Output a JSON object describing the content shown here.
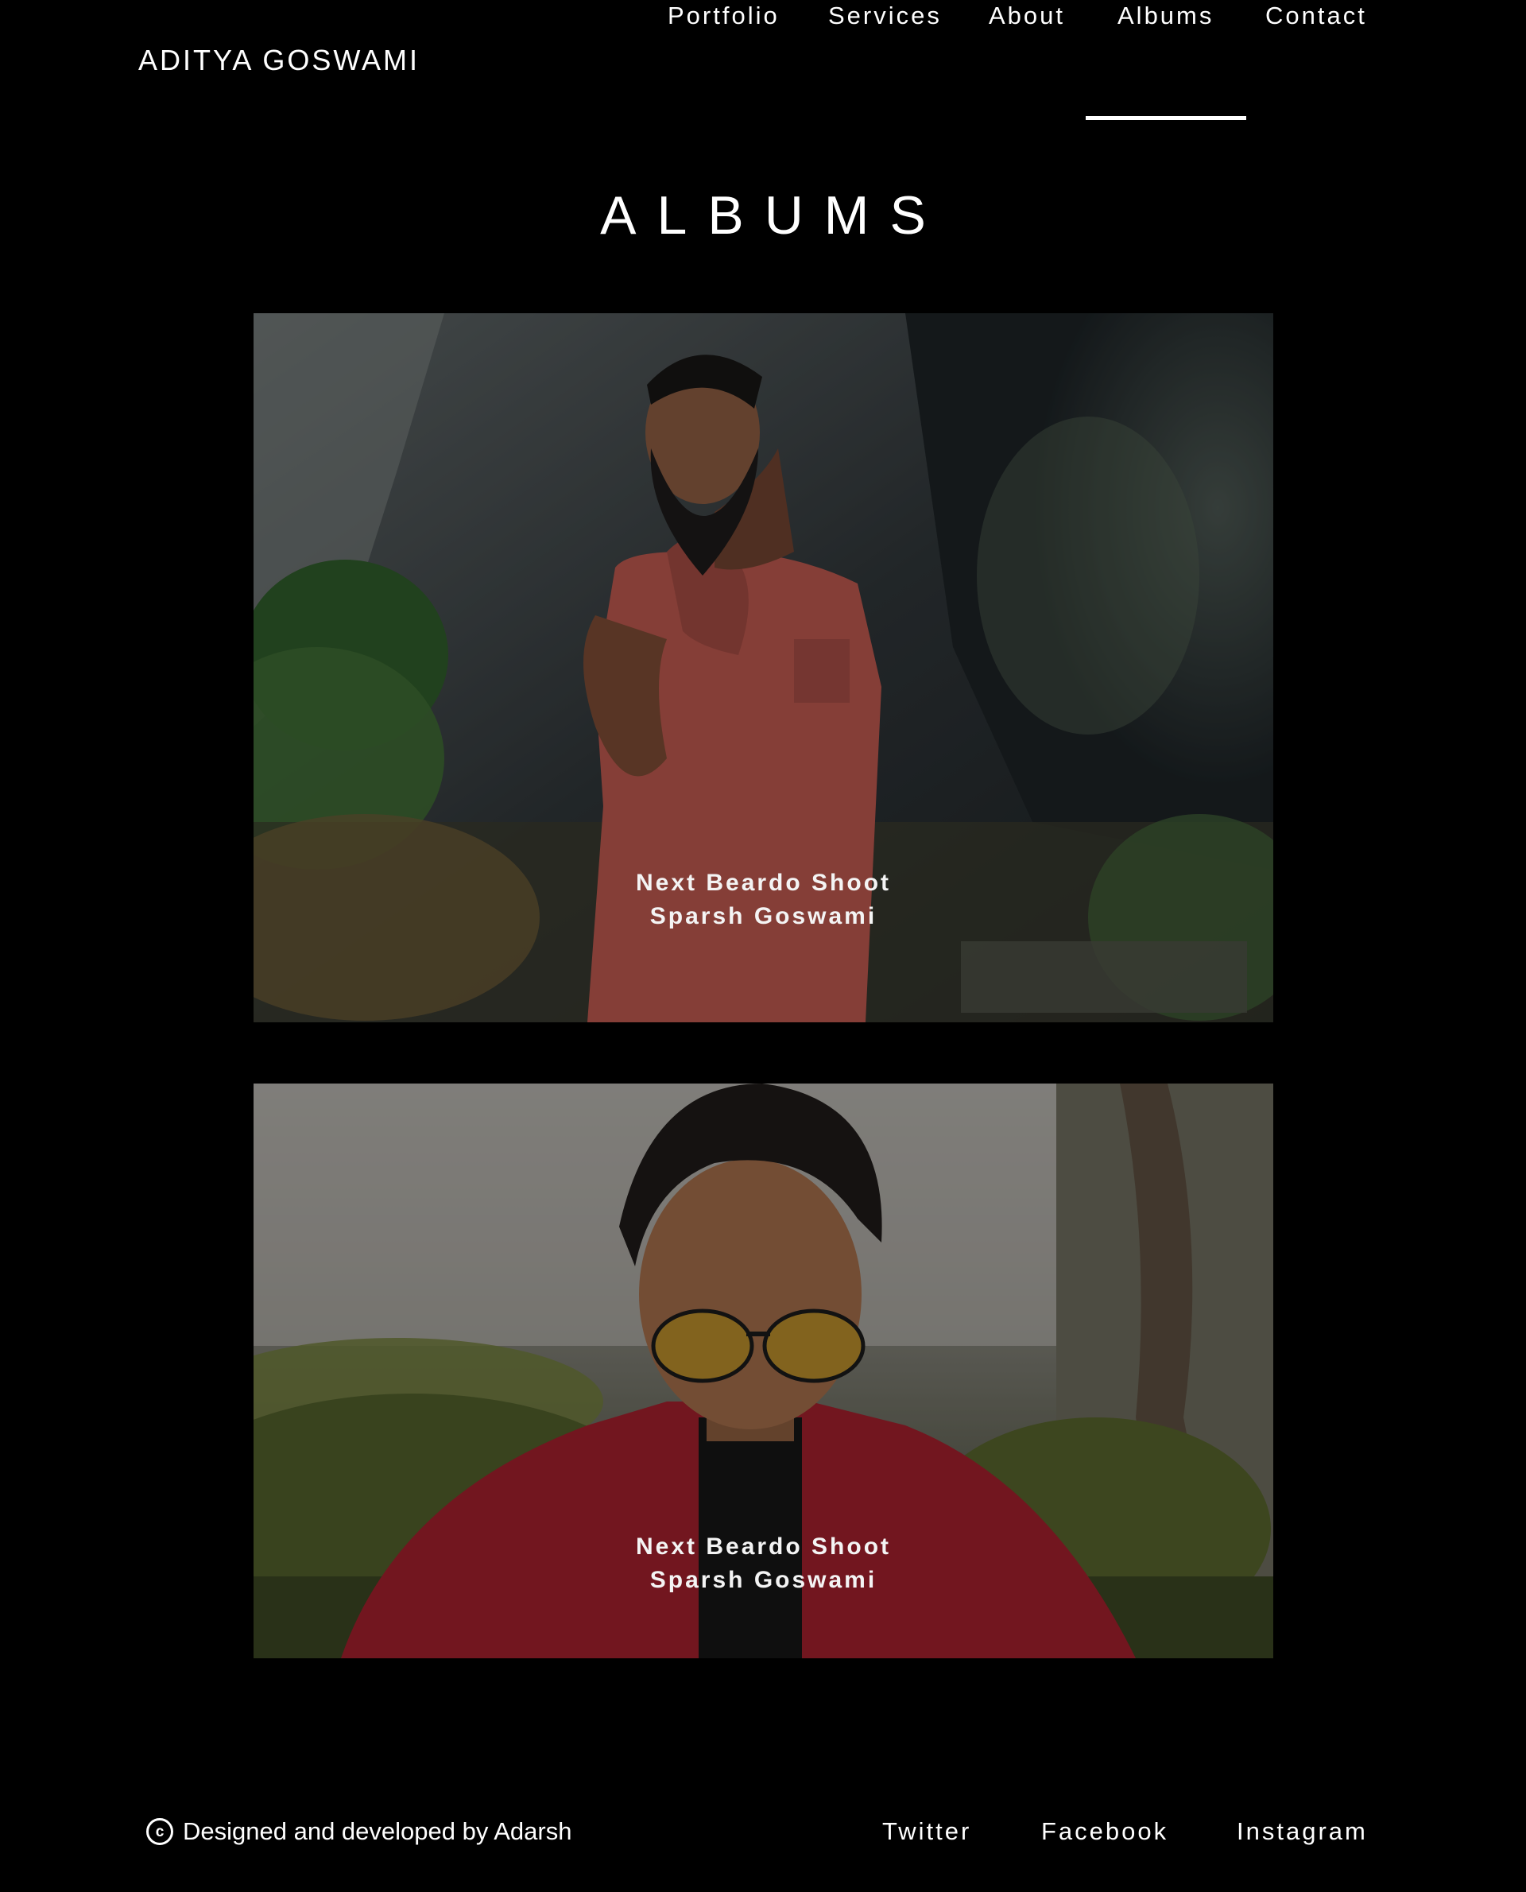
{
  "header": {
    "brand": "ADITYA GOSWAMI",
    "nav": [
      {
        "label": "Portfolio"
      },
      {
        "label": "Services"
      },
      {
        "label": "About"
      },
      {
        "label": "Albums",
        "active": true
      },
      {
        "label": "Contact"
      }
    ]
  },
  "main": {
    "title": "ALBUMS",
    "albums": [
      {
        "caption_line1": "Next Beardo Shoot",
        "caption_line2": "Sparsh Goswami",
        "photo": "man-red-sleeveless-shirt-mountains"
      },
      {
        "caption_line1": "Next Beardo Shoot",
        "caption_line2": "Sparsh Goswami",
        "photo": "man-yellow-sunglasses-red-jacket"
      }
    ]
  },
  "footer": {
    "copyright_icon": "copyright-icon",
    "credit": "Designed and developed by Adarsh",
    "social": [
      {
        "label": "Twitter"
      },
      {
        "label": "Facebook"
      },
      {
        "label": "Instagram"
      }
    ]
  },
  "colors": {
    "background": "#000000",
    "text": "#ffffff",
    "active_underline": "#ffffff"
  }
}
